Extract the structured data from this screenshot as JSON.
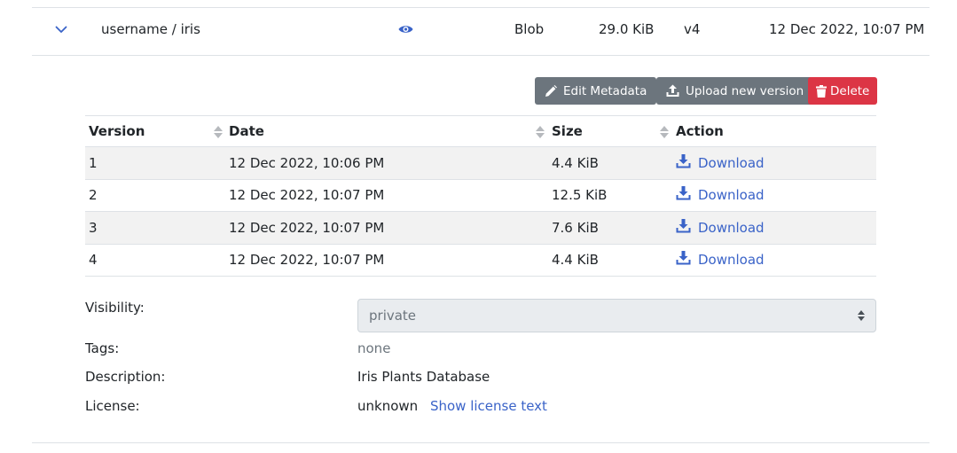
{
  "dataset": {
    "owner": "username",
    "separator": " / ",
    "name": "iris",
    "type": "Blob",
    "size": "29.0 KiB",
    "version": "v4",
    "date": "12 Dec 2022, 10:07 PM"
  },
  "actions": {
    "edit_label": "Edit Metadata",
    "upload_label": "Upload new version",
    "delete_label": "Delete"
  },
  "versions_table": {
    "columns": [
      "Version",
      "Date",
      "Size",
      "Action"
    ],
    "rows": [
      {
        "version": "1",
        "date": "12 Dec 2022, 10:06 PM",
        "size": "4.4 KiB",
        "action": "Download"
      },
      {
        "version": "2",
        "date": "12 Dec 2022, 10:07 PM",
        "size": "12.5 KiB",
        "action": "Download"
      },
      {
        "version": "3",
        "date": "12 Dec 2022, 10:07 PM",
        "size": "7.6 KiB",
        "action": "Download"
      },
      {
        "version": "4",
        "date": "12 Dec 2022, 10:07 PM",
        "size": "4.4 KiB",
        "action": "Download"
      }
    ]
  },
  "details": {
    "visibility_label": "Visibility:",
    "visibility_value": "private",
    "tags_label": "Tags:",
    "tags_value": "none",
    "description_label": "Description:",
    "description_value": "Iris Plants Database",
    "license_label": "License:",
    "license_value": "unknown",
    "license_link": "Show license text"
  },
  "colors": {
    "accent": "#3a63c8",
    "button_gray": "#6c757d",
    "button_danger": "#dc3545",
    "stripe": "#f2f2f2"
  },
  "icons": {
    "expand": "chevron-down-icon",
    "visibility": "eye-icon",
    "edit": "pencil-icon",
    "upload": "upload-icon",
    "delete": "trash-icon",
    "download": "download-icon",
    "sort": "sort-icon"
  }
}
